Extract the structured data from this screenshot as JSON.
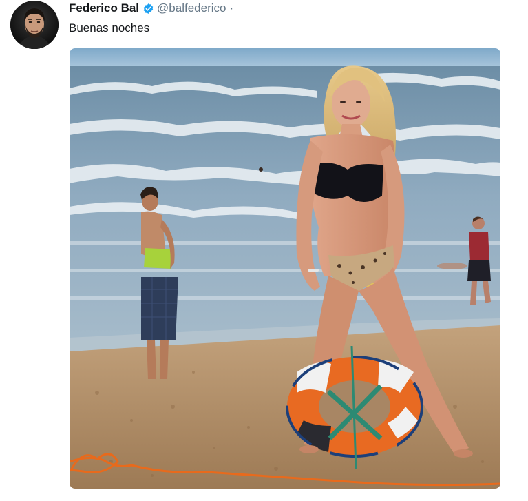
{
  "tweet": {
    "author": {
      "display_name": "Federico Bal",
      "handle": "@balfederico",
      "separator": "·",
      "verified": true,
      "avatar_icon": "profile-photo"
    },
    "text": "Buenas noches",
    "media": {
      "type": "photo",
      "description_icon": "beach-photo"
    }
  },
  "colors": {
    "verified_blue": "#1da1f2",
    "secondary_text": "#657786",
    "primary_text": "#14171a"
  }
}
